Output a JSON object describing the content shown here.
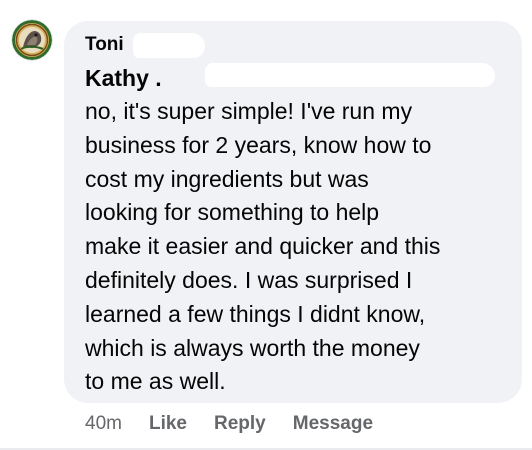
{
  "comment": {
    "author": "Toni",
    "mention": "Kathy .",
    "lines": [
      "no, it's super simple!  I've run my",
      "business for 2 years, know how to",
      "cost my ingredients but was",
      "looking for something to help",
      "make it easier and quicker and this",
      "definitely does. I was surprised I",
      "learned a few things I didnt know,",
      "which is always worth the money",
      "to me as well."
    ],
    "timestamp": "40m",
    "actions": {
      "like": "Like",
      "reply": "Reply",
      "message": "Message"
    }
  },
  "colors": {
    "bubble": "#f0f2f5",
    "text": "#050505",
    "secondary": "#65676b"
  }
}
